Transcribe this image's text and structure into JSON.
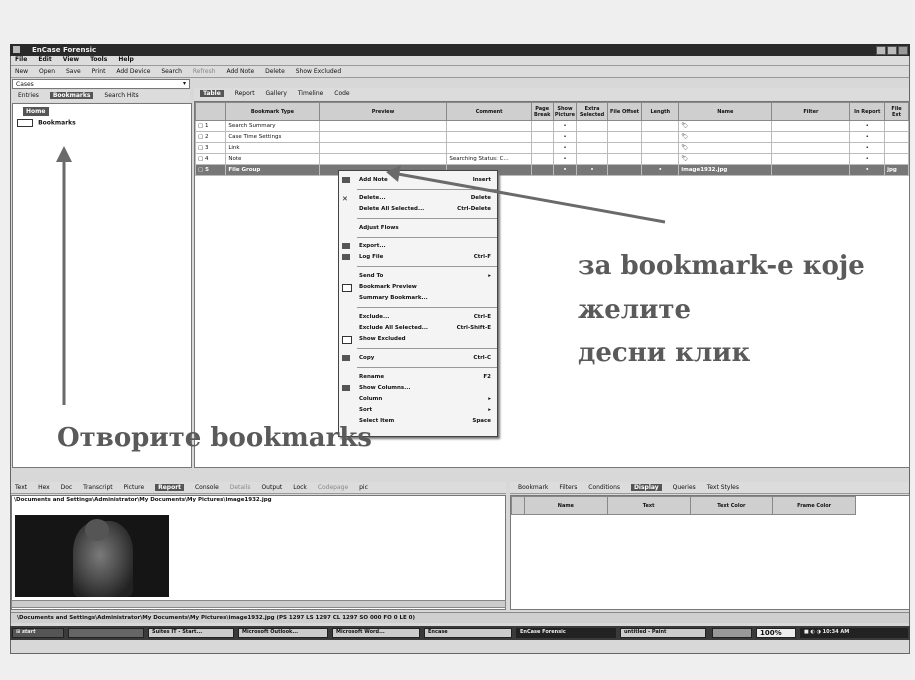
{
  "window": {
    "title": "EnCase Forensic"
  },
  "menubar": [
    "File",
    "Edit",
    "View",
    "Tools",
    "Help"
  ],
  "toolbar": [
    "New",
    "Open",
    "Save",
    "Print",
    "Add Device",
    "Search",
    "Refresh",
    "Add Note",
    "Delete",
    "Show Excluded"
  ],
  "left_pane": {
    "dropdown": "Cases",
    "tabs": [
      "Entries",
      "Bookmarks",
      "Search Hits"
    ],
    "home_label": "Home",
    "tree_item": "Bookmarks"
  },
  "view_tabs": [
    "Table",
    "Report",
    "Gallery",
    "Timeline",
    "Code"
  ],
  "table": {
    "columns": [
      "Bookmark Type",
      "Preview",
      "Comment",
      "Page Break",
      "Show Picture",
      "Extra Selected",
      "File Offset",
      "Length",
      "Name",
      "Filter",
      "In Report",
      "File Ext"
    ],
    "rows": [
      {
        "type": "Search Summary",
        "comment": ""
      },
      {
        "type": "Case Time Settings",
        "comment": ""
      },
      {
        "type": "Link",
        "comment": ""
      },
      {
        "type": "Note",
        "comment": "Searching Status: C..."
      },
      {
        "type": "File Group",
        "comment": "",
        "name": "image1932.jpg",
        "ext": "jpg"
      }
    ]
  },
  "context_menu": {
    "groups": [
      [
        {
          "label": "Add Note",
          "shortcut": "Insert"
        }
      ],
      [
        {
          "label": "Delete...",
          "shortcut": "Delete"
        },
        {
          "label": "Delete All Selected...",
          "shortcut": "Ctrl-Delete"
        }
      ],
      [
        {
          "label": "Adjust Flows",
          "shortcut": ""
        }
      ],
      [
        {
          "label": "Export...",
          "shortcut": ""
        },
        {
          "label": "Log File",
          "shortcut": "Ctrl-F"
        }
      ],
      [
        {
          "label": "Send To",
          "shortcut": "▸"
        },
        {
          "label": "Bookmark Preview",
          "shortcut": ""
        },
        {
          "label": "Summary Bookmark...",
          "shortcut": ""
        }
      ],
      [
        {
          "label": "Exclude...",
          "shortcut": "Ctrl-E"
        },
        {
          "label": "Exclude All Selected...",
          "shortcut": "Ctrl-Shift-E"
        },
        {
          "label": "Show Excluded",
          "shortcut": ""
        }
      ],
      [
        {
          "label": "Copy",
          "shortcut": "Ctrl-C"
        }
      ],
      [
        {
          "label": "Rename",
          "shortcut": "F2"
        },
        {
          "label": "Show Columns...",
          "shortcut": ""
        },
        {
          "label": "Column",
          "shortcut": "▸"
        },
        {
          "label": "Sort",
          "shortcut": "▸"
        },
        {
          "label": "Select Item",
          "shortcut": "Space"
        }
      ]
    ]
  },
  "annotations": {
    "right_lines": [
      "за bookmark-е које",
      "желите",
      "десни клик"
    ],
    "bottom_left": "Отворите bookmarks"
  },
  "bottom_tabs": [
    "Text",
    "Hex",
    "Doc",
    "Transcript",
    "Picture",
    "Report",
    "Console",
    "Details",
    "Output",
    "Lock",
    "Codepage",
    "pic"
  ],
  "file_path": "\\Documents and Settings\\Administrator\\My Documents\\My Pictures\\image1932.jpg",
  "right_bottom_tabs": [
    "Bookmark",
    "Filters",
    "Conditions",
    "Display",
    "Queries",
    "Text Styles"
  ],
  "right_bottom_columns": [
    "Name",
    "Text",
    "Text Color",
    "Frame Color"
  ],
  "status_text": "\\Documents and Settings\\Administrator\\My Documents\\My Pictures\\image1932.jpg (PS 1297 LS 1297 CL 1297 SO 000 FO 0 LE 0)",
  "taskbar": {
    "start": "start",
    "items": [
      "Suites IT - Start...",
      "Microsoft Outlook...",
      "Microsoft Word...",
      "Encase",
      "EnCase Forensic",
      "untitled - Paint"
    ],
    "zoom": "100%",
    "time": "10:34 AM"
  }
}
